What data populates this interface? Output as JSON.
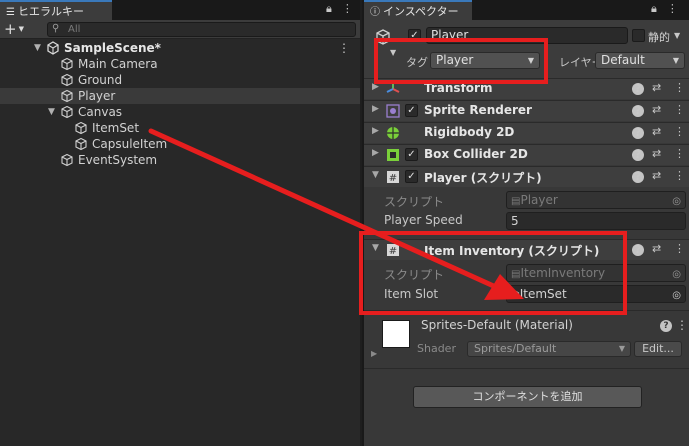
{
  "hierarchy": {
    "tab_label": "ヒエラルキー",
    "search_placeholder": "All",
    "items": [
      {
        "label": "SampleScene*",
        "depth": 0,
        "expanded": true
      },
      {
        "label": "Main Camera",
        "depth": 1
      },
      {
        "label": "Ground",
        "depth": 1
      },
      {
        "label": "Player",
        "depth": 1,
        "selected": true
      },
      {
        "label": "Canvas",
        "depth": 1,
        "expanded": true
      },
      {
        "label": "ItemSet",
        "depth": 2
      },
      {
        "label": "CapsuleItem",
        "depth": 2
      },
      {
        "label": "EventSystem",
        "depth": 1
      }
    ]
  },
  "inspector": {
    "tab_label": "インスペクター",
    "object_name": "Player",
    "static_label": "静的",
    "tag_label": "タグ",
    "tag_value": "Player",
    "layer_label": "レイヤー",
    "layer_value": "Default",
    "components": [
      {
        "name": "Transform"
      },
      {
        "name": "Sprite Renderer"
      },
      {
        "name": "Rigidbody 2D"
      },
      {
        "name": "Box Collider 2D"
      },
      {
        "name": "Player (スクリプト)"
      },
      {
        "name": "Item Inventory (スクリプト)"
      }
    ],
    "player_script": {
      "script_label": "スクリプト",
      "script_value": "Player",
      "speed_label": "Player Speed",
      "speed_value": "5"
    },
    "inventory_script": {
      "script_label": "スクリプト",
      "script_value": "ItemInventory",
      "slot_label": "Item Slot",
      "slot_value": "ItemSet"
    },
    "material": {
      "name": "Sprites-Default (Material)",
      "shader_label": "Shader",
      "shader_value": "Sprites/Default",
      "edit_label": "Edit..."
    },
    "add_component_label": "コンポーネントを追加"
  },
  "colors": {
    "annotation_red": "#e61e1e",
    "selection_bg": "#3a3a3a",
    "tab_accent": "#3a79bb"
  }
}
